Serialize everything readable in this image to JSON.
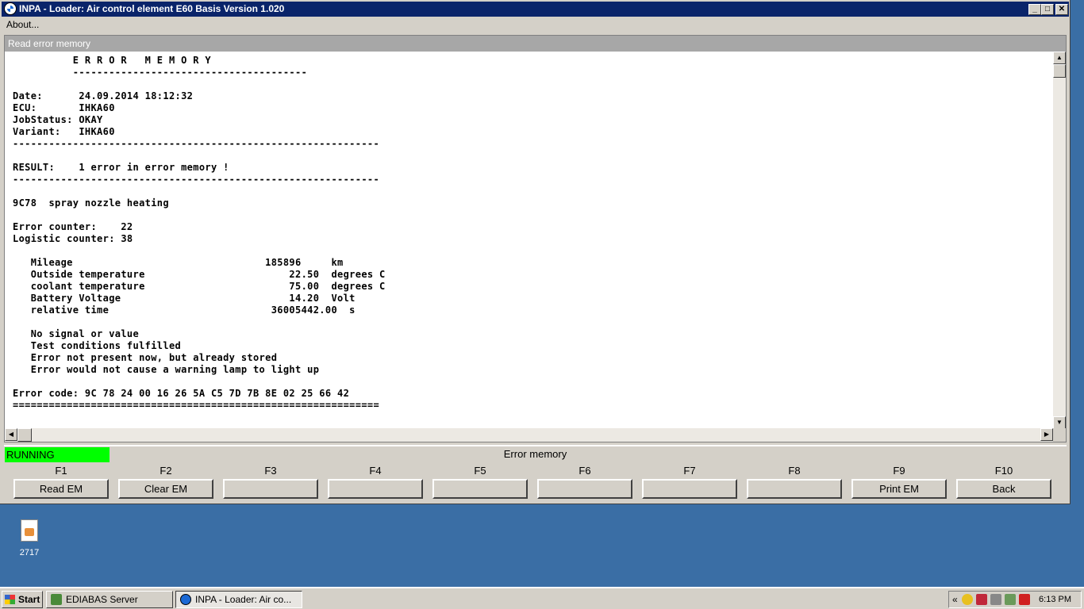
{
  "window": {
    "title": "INPA - Loader:  Air control element E60 Basis Version 1.020",
    "controls": {
      "minimize": "_",
      "maximize": "□",
      "close": "✕"
    }
  },
  "menu": {
    "about": "About..."
  },
  "panel": {
    "header": "Read error memory",
    "text": "          E R R O R   M E M O R Y\n          ---------------------------------------\n\nDate:      24.09.2014 18:12:32\nECU:       IHKA60\nJobStatus: OKAY\nVariant:   IHKA60\n-------------------------------------------------------------\n\nRESULT:    1 error in error memory !\n-------------------------------------------------------------\n\n9C78  spray nozzle heating\n\nError counter:    22\nLogistic counter: 38\n\n   Mileage                                185896     km\n   Outside temperature                        22.50  degrees C\n   coolant temperature                        75.00  degrees C\n   Battery Voltage                            14.20  Volt\n   relative time                           36005442.00  s\n\n   No signal or value\n   Test conditions fulfilled\n   Error not present now, but already stored\n   Error would not cause a warning lamp to light up\n\nError code: 9C 78 24 00 16 26 5A C5 7D 7B 8E 02 25 66 42\n============================================================="
  },
  "status": {
    "state": "RUNNING",
    "title": "Error memory",
    "state_color": "#00ff00"
  },
  "function_keys": [
    {
      "key": "F1",
      "label": "Read EM"
    },
    {
      "key": "F2",
      "label": "Clear EM"
    },
    {
      "key": "F3",
      "label": ""
    },
    {
      "key": "F4",
      "label": ""
    },
    {
      "key": "F5",
      "label": ""
    },
    {
      "key": "F6",
      "label": ""
    },
    {
      "key": "F7",
      "label": ""
    },
    {
      "key": "F8",
      "label": ""
    },
    {
      "key": "F9",
      "label": "Print EM"
    },
    {
      "key": "F10",
      "label": "Back"
    }
  ],
  "desktop": {
    "icon_label": "2717",
    "icon": "file-icon"
  },
  "taskbar": {
    "start": "Start",
    "tasks": [
      {
        "label": "EDIABAS Server",
        "icon": "ediabas-icon",
        "active": false
      },
      {
        "label": "INPA - Loader:  Air co...",
        "icon": "bmw-icon",
        "active": true
      }
    ],
    "tray_chevron": "«",
    "clock": "6:13 PM"
  },
  "colors": {
    "titlebar": "#0a246a",
    "desktop": "#3a6ea5",
    "panel_header": "#a7a7a7"
  }
}
